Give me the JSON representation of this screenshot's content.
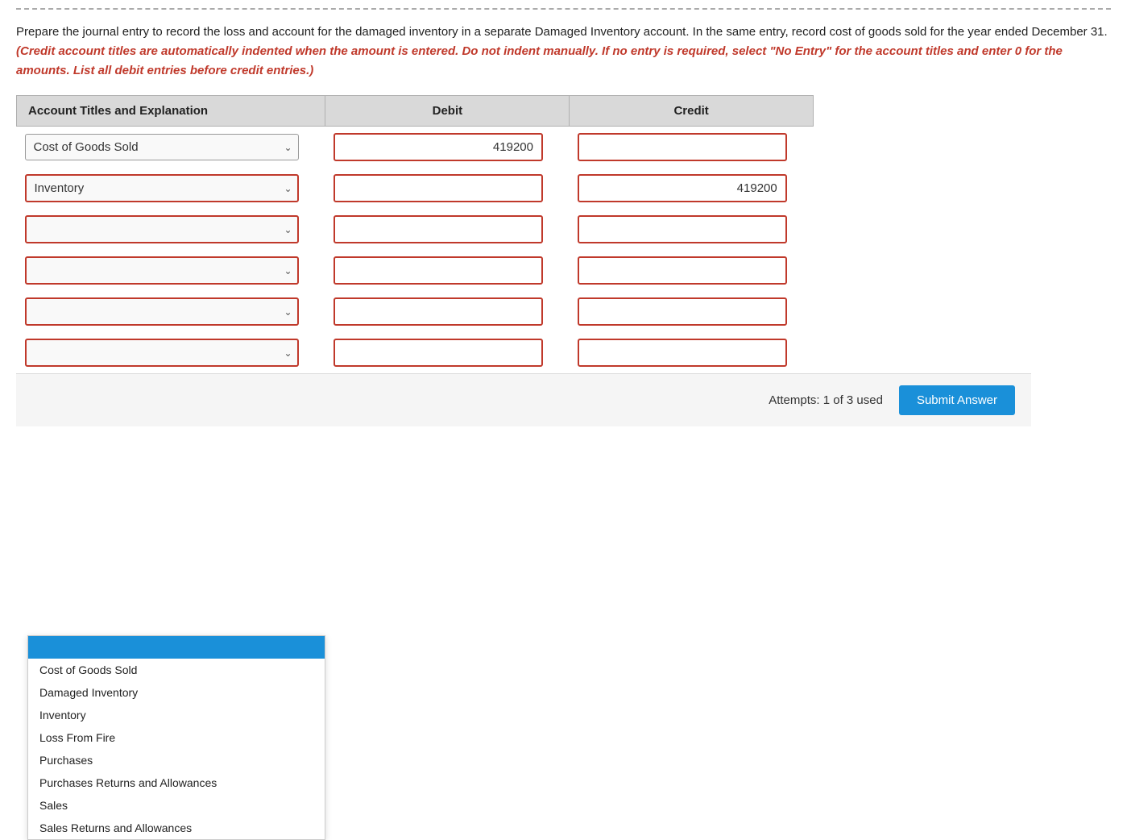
{
  "topBorder": true,
  "instructions": {
    "line1": "Prepare the journal entry to record the loss and account for the damaged inventory in a separate Damaged Inventory account. In",
    "line2": "the same entry, record cost of goods sold for the year ended December 31.",
    "redItalic": "(Credit account titles are automatically indented when the amount is entered. Do not indent manually. If no entry is required, select \"No Entry\" for the account titles and enter 0 for the amounts. List all debit entries before credit entries.)"
  },
  "table": {
    "headers": [
      "Account Titles and Explanation",
      "Debit",
      "Credit"
    ],
    "rows": [
      {
        "account": "Cost of Goods Sold",
        "debit": "419200",
        "credit": "",
        "accountBorderGreen": true
      },
      {
        "account": "Inventory",
        "debit": "",
        "credit": "419200",
        "accountBorderRed": true
      },
      {
        "account": "",
        "debit": "",
        "credit": "",
        "accountBorderRed": true
      },
      {
        "account": "",
        "debit": "",
        "credit": "",
        "accountBorderRed": true
      },
      {
        "account": "",
        "debit": "",
        "credit": "",
        "accountBorderRed": true
      },
      {
        "account": "",
        "debit": "",
        "credit": "",
        "accountBorderRed": true
      }
    ]
  },
  "dropdown": {
    "items": [
      "Cost of Goods Sold",
      "Damaged Inventory",
      "Inventory",
      "Loss From Fire",
      "Purchases",
      "Purchases Returns and Allowances",
      "Sales",
      "Sales Returns and Allowances"
    ]
  },
  "footer": {
    "attemptsText": "Attempts: 1 of 3 used",
    "submitLabel": "Submit Answer"
  }
}
